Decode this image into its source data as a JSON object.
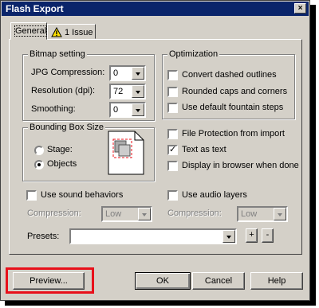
{
  "window": {
    "title": "Flash Export",
    "close_glyph": "×"
  },
  "tabs": [
    {
      "label": "General",
      "active": true
    },
    {
      "label": "1 Issue",
      "icon": "warning-icon",
      "active": false
    }
  ],
  "bitmap": {
    "group_title": "Bitmap setting",
    "jpg_label": "JPG Compression:",
    "jpg_value": "0",
    "res_label": "Resolution (dpi):",
    "res_value": "72",
    "smooth_label": "Smoothing:",
    "smooth_value": "0"
  },
  "optimization": {
    "group_title": "Optimization",
    "items": [
      {
        "label": "Convert dashed outlines",
        "checked": false
      },
      {
        "label": "Rounded caps and corners",
        "checked": false
      },
      {
        "label": "Use default fountain steps",
        "checked": false
      }
    ]
  },
  "bounding": {
    "group_title": "Bounding Box Size",
    "stage_label": "Stage:",
    "objects_label": "Objects",
    "selected": "Objects",
    "icon": "bounding-box-icon"
  },
  "options": [
    {
      "label": "File Protection from import",
      "checked": false
    },
    {
      "label": "Text as text",
      "checked": true
    },
    {
      "label": "Display in browser when done",
      "checked": false
    }
  ],
  "sound": {
    "behaviors_label": "Use sound behaviors",
    "compression_label": "Compression:",
    "compression_value": "Low",
    "audio_label": "Use audio layers",
    "audio_compression_label": "Compression:",
    "audio_compression_value": "Low"
  },
  "presets": {
    "label": "Presets:",
    "value": "",
    "add_label": "+",
    "remove_label": "-"
  },
  "buttons": {
    "preview": "Preview...",
    "ok": "OK",
    "cancel": "Cancel",
    "help": "Help"
  },
  "colors": {
    "titlebar": "#0a246a",
    "face": "#d4d0c8",
    "highlight": "#e8101a"
  }
}
